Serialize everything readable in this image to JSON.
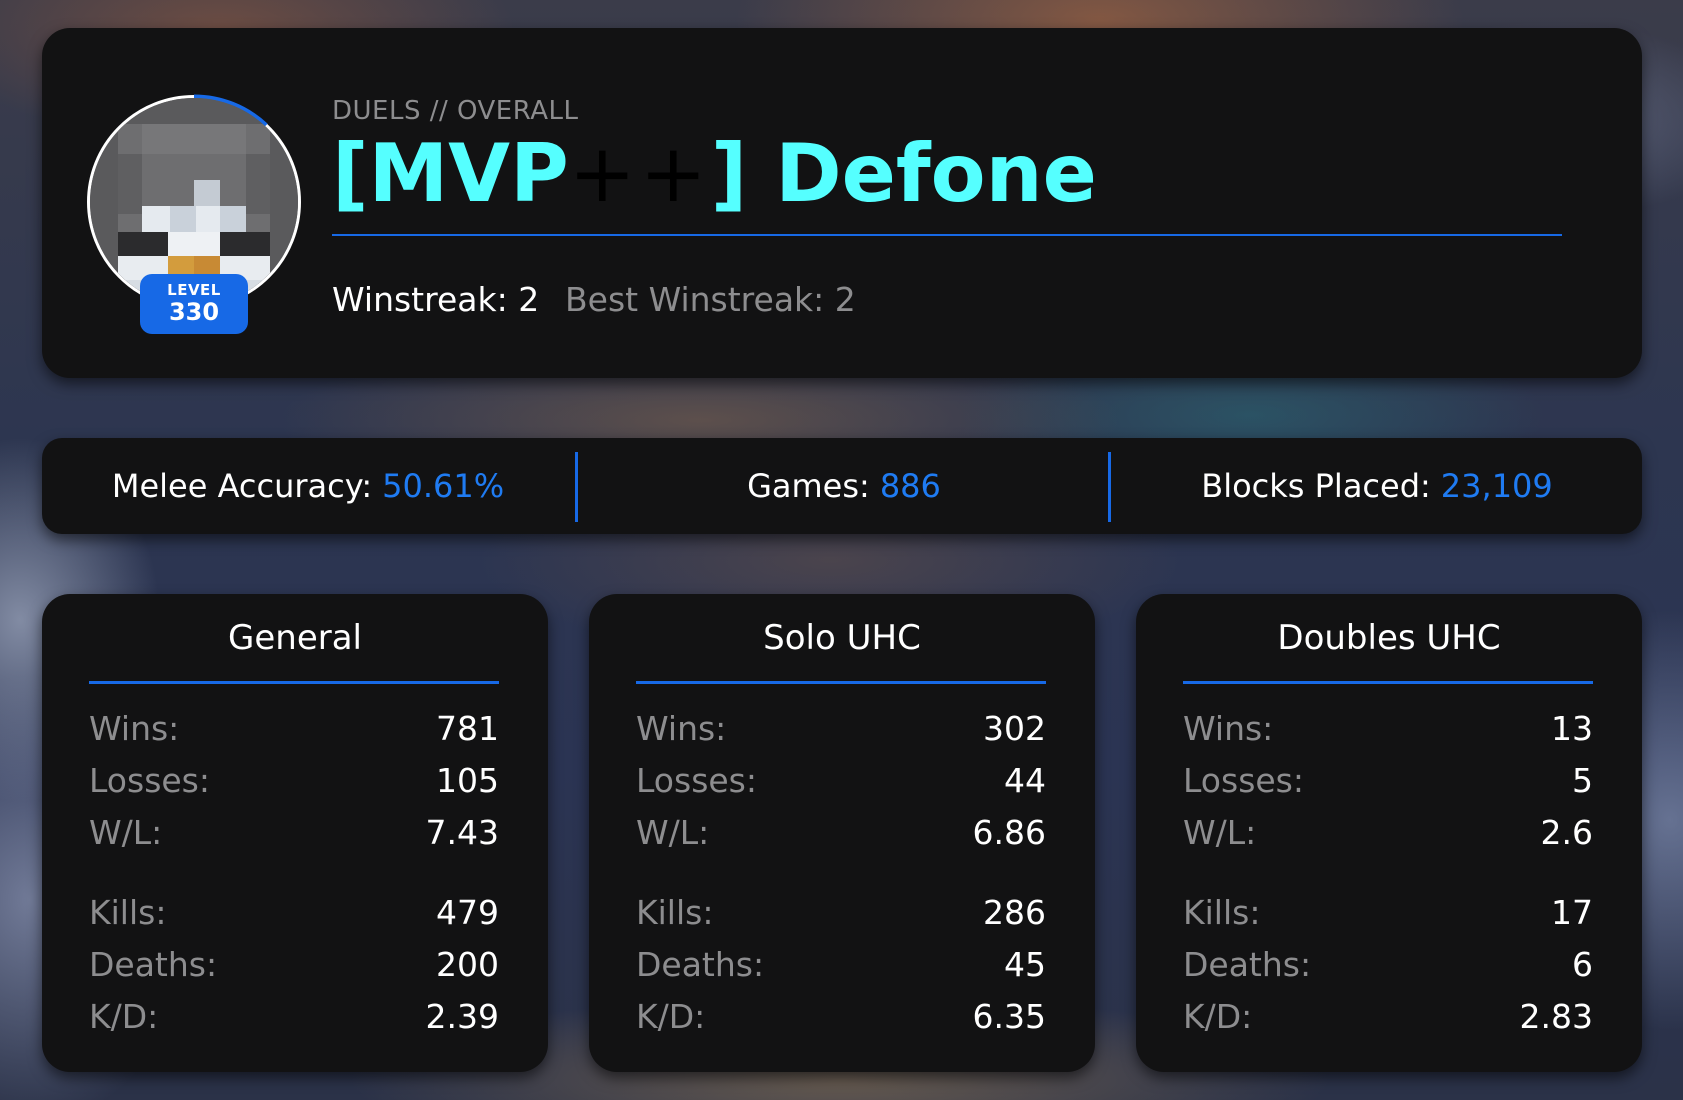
{
  "header": {
    "subtitle": "DUELS // OVERALL",
    "player": {
      "bracket_open": "[",
      "rank": "MVP",
      "plus": "++",
      "bracket_close": "]",
      "name": "Defone"
    },
    "name_color": "#55ffff",
    "plus_color": "#000000",
    "level_label": "LEVEL",
    "level_value": "330",
    "winstreak": "Winstreak: 2",
    "best_winstreak": "Best Winstreak: 2"
  },
  "summary": [
    {
      "label": "Melee Accuracy:",
      "value": "50.61%"
    },
    {
      "label": "Games:",
      "value": "886"
    },
    {
      "label": "Blocks Placed:",
      "value": "23,109"
    }
  ],
  "panels": [
    {
      "title": "General",
      "rows": [
        {
          "label": "Wins:",
          "value": "781"
        },
        {
          "label": "Losses:",
          "value": "105"
        },
        {
          "label": "W/L:",
          "value": "7.43"
        },
        {
          "label": "Kills:",
          "value": "479"
        },
        {
          "label": "Deaths:",
          "value": "200"
        },
        {
          "label": "K/D:",
          "value": "2.39"
        }
      ]
    },
    {
      "title": "Solo UHC",
      "rows": [
        {
          "label": "Wins:",
          "value": "302"
        },
        {
          "label": "Losses:",
          "value": "44"
        },
        {
          "label": "W/L:",
          "value": "6.86"
        },
        {
          "label": "Kills:",
          "value": "286"
        },
        {
          "label": "Deaths:",
          "value": "45"
        },
        {
          "label": "K/D:",
          "value": "6.35"
        }
      ]
    },
    {
      "title": "Doubles UHC",
      "rows": [
        {
          "label": "Wins:",
          "value": "13"
        },
        {
          "label": "Losses:",
          "value": "5"
        },
        {
          "label": "W/L:",
          "value": "2.6"
        },
        {
          "label": "Kills:",
          "value": "17"
        },
        {
          "label": "Deaths:",
          "value": "6"
        },
        {
          "label": "K/D:",
          "value": "2.83"
        }
      ]
    }
  ],
  "level_progress": 0.12,
  "colors": {
    "accent": "#1769e6",
    "value_blue": "#1f7bf2",
    "card_bg": "#121213",
    "muted_text": "#8d8d8f"
  }
}
